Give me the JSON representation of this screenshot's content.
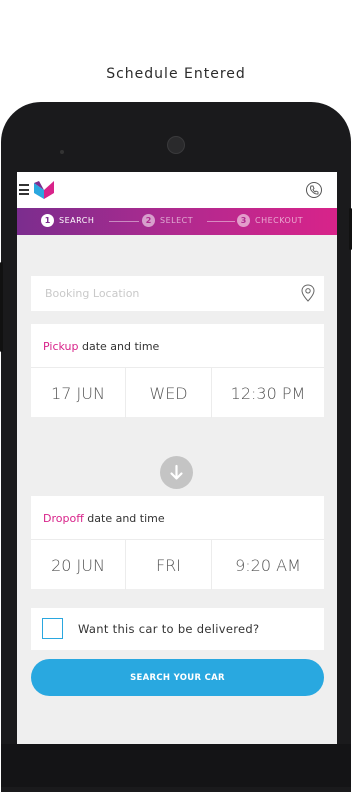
{
  "caption": "Schedule Entered",
  "colors": {
    "brand_purple": "#7b2d8e",
    "brand_magenta": "#d8238a",
    "accent_blue": "#29a8e0",
    "background": "#efefef"
  },
  "app_bar": {
    "menu_icon": "hamburger-menu-icon",
    "logo_icon": "brand-logo-icon",
    "action_icon": "phone-assist-icon"
  },
  "steps": [
    {
      "number": "1",
      "label": "SEARCH",
      "active": true
    },
    {
      "number": "2",
      "label": "SELECT",
      "active": false
    },
    {
      "number": "3",
      "label": "CHECKOUT",
      "active": false
    }
  ],
  "location": {
    "placeholder": "Booking Location",
    "value": "",
    "icon": "location-pin-icon"
  },
  "pickup": {
    "title_accent": "Pickup",
    "title_rest": " date and time",
    "date": "17 JUN",
    "day": "WED",
    "time": "12:30 PM"
  },
  "swap_icon": "arrow-down-icon",
  "dropoff": {
    "title_accent": "Dropoff",
    "title_rest": " date and time",
    "date": "20 JUN",
    "day": "FRI",
    "time": "9:20 AM"
  },
  "delivery": {
    "label": "Want this car to be delivered?",
    "checked": false
  },
  "search_button": {
    "label": "SEARCH YOUR CAR"
  }
}
